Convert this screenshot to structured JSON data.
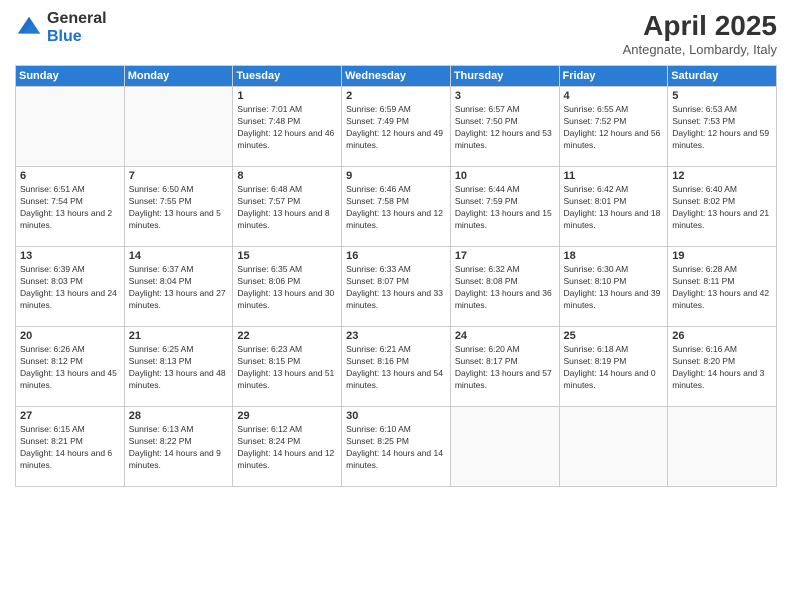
{
  "logo": {
    "general": "General",
    "blue": "Blue"
  },
  "title": "April 2025",
  "location": "Antegnate, Lombardy, Italy",
  "days_of_week": [
    "Sunday",
    "Monday",
    "Tuesday",
    "Wednesday",
    "Thursday",
    "Friday",
    "Saturday"
  ],
  "weeks": [
    [
      {
        "day": "",
        "info": ""
      },
      {
        "day": "",
        "info": ""
      },
      {
        "day": "1",
        "info": "Sunrise: 7:01 AM\nSunset: 7:48 PM\nDaylight: 12 hours and 46 minutes."
      },
      {
        "day": "2",
        "info": "Sunrise: 6:59 AM\nSunset: 7:49 PM\nDaylight: 12 hours and 49 minutes."
      },
      {
        "day": "3",
        "info": "Sunrise: 6:57 AM\nSunset: 7:50 PM\nDaylight: 12 hours and 53 minutes."
      },
      {
        "day": "4",
        "info": "Sunrise: 6:55 AM\nSunset: 7:52 PM\nDaylight: 12 hours and 56 minutes."
      },
      {
        "day": "5",
        "info": "Sunrise: 6:53 AM\nSunset: 7:53 PM\nDaylight: 12 hours and 59 minutes."
      }
    ],
    [
      {
        "day": "6",
        "info": "Sunrise: 6:51 AM\nSunset: 7:54 PM\nDaylight: 13 hours and 2 minutes."
      },
      {
        "day": "7",
        "info": "Sunrise: 6:50 AM\nSunset: 7:55 PM\nDaylight: 13 hours and 5 minutes."
      },
      {
        "day": "8",
        "info": "Sunrise: 6:48 AM\nSunset: 7:57 PM\nDaylight: 13 hours and 8 minutes."
      },
      {
        "day": "9",
        "info": "Sunrise: 6:46 AM\nSunset: 7:58 PM\nDaylight: 13 hours and 12 minutes."
      },
      {
        "day": "10",
        "info": "Sunrise: 6:44 AM\nSunset: 7:59 PM\nDaylight: 13 hours and 15 minutes."
      },
      {
        "day": "11",
        "info": "Sunrise: 6:42 AM\nSunset: 8:01 PM\nDaylight: 13 hours and 18 minutes."
      },
      {
        "day": "12",
        "info": "Sunrise: 6:40 AM\nSunset: 8:02 PM\nDaylight: 13 hours and 21 minutes."
      }
    ],
    [
      {
        "day": "13",
        "info": "Sunrise: 6:39 AM\nSunset: 8:03 PM\nDaylight: 13 hours and 24 minutes."
      },
      {
        "day": "14",
        "info": "Sunrise: 6:37 AM\nSunset: 8:04 PM\nDaylight: 13 hours and 27 minutes."
      },
      {
        "day": "15",
        "info": "Sunrise: 6:35 AM\nSunset: 8:06 PM\nDaylight: 13 hours and 30 minutes."
      },
      {
        "day": "16",
        "info": "Sunrise: 6:33 AM\nSunset: 8:07 PM\nDaylight: 13 hours and 33 minutes."
      },
      {
        "day": "17",
        "info": "Sunrise: 6:32 AM\nSunset: 8:08 PM\nDaylight: 13 hours and 36 minutes."
      },
      {
        "day": "18",
        "info": "Sunrise: 6:30 AM\nSunset: 8:10 PM\nDaylight: 13 hours and 39 minutes."
      },
      {
        "day": "19",
        "info": "Sunrise: 6:28 AM\nSunset: 8:11 PM\nDaylight: 13 hours and 42 minutes."
      }
    ],
    [
      {
        "day": "20",
        "info": "Sunrise: 6:26 AM\nSunset: 8:12 PM\nDaylight: 13 hours and 45 minutes."
      },
      {
        "day": "21",
        "info": "Sunrise: 6:25 AM\nSunset: 8:13 PM\nDaylight: 13 hours and 48 minutes."
      },
      {
        "day": "22",
        "info": "Sunrise: 6:23 AM\nSunset: 8:15 PM\nDaylight: 13 hours and 51 minutes."
      },
      {
        "day": "23",
        "info": "Sunrise: 6:21 AM\nSunset: 8:16 PM\nDaylight: 13 hours and 54 minutes."
      },
      {
        "day": "24",
        "info": "Sunrise: 6:20 AM\nSunset: 8:17 PM\nDaylight: 13 hours and 57 minutes."
      },
      {
        "day": "25",
        "info": "Sunrise: 6:18 AM\nSunset: 8:19 PM\nDaylight: 14 hours and 0 minutes."
      },
      {
        "day": "26",
        "info": "Sunrise: 6:16 AM\nSunset: 8:20 PM\nDaylight: 14 hours and 3 minutes."
      }
    ],
    [
      {
        "day": "27",
        "info": "Sunrise: 6:15 AM\nSunset: 8:21 PM\nDaylight: 14 hours and 6 minutes."
      },
      {
        "day": "28",
        "info": "Sunrise: 6:13 AM\nSunset: 8:22 PM\nDaylight: 14 hours and 9 minutes."
      },
      {
        "day": "29",
        "info": "Sunrise: 6:12 AM\nSunset: 8:24 PM\nDaylight: 14 hours and 12 minutes."
      },
      {
        "day": "30",
        "info": "Sunrise: 6:10 AM\nSunset: 8:25 PM\nDaylight: 14 hours and 14 minutes."
      },
      {
        "day": "",
        "info": ""
      },
      {
        "day": "",
        "info": ""
      },
      {
        "day": "",
        "info": ""
      }
    ]
  ]
}
